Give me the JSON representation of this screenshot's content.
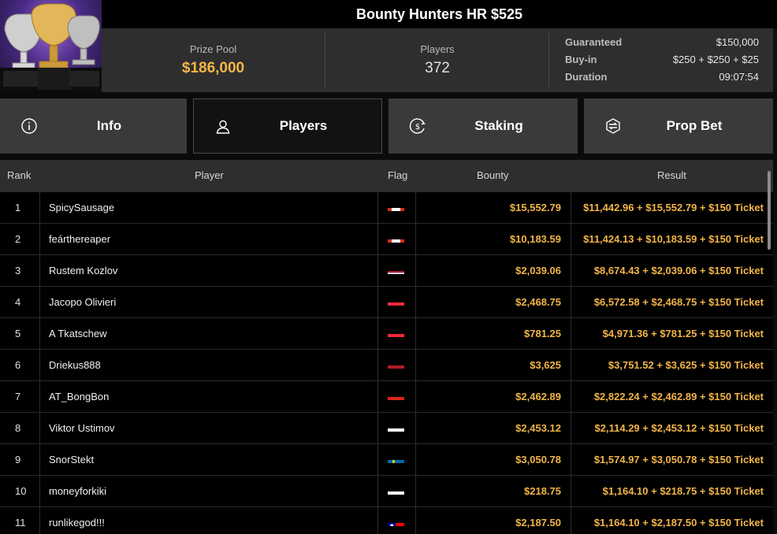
{
  "header": {
    "title": "Bounty Hunters HR $525",
    "prize_pool_label": "Prize Pool",
    "prize_pool_value": "$186,000",
    "players_label": "Players",
    "players_value": "372",
    "details": [
      {
        "key": "Guaranteed",
        "value": "$150,000"
      },
      {
        "key": "Buy-in",
        "value": "$250 + $250 + $25"
      },
      {
        "key": "Duration",
        "value": "09:07:54"
      }
    ]
  },
  "tabs": [
    {
      "label": "Info",
      "icon": "info-icon",
      "active": false
    },
    {
      "label": "Players",
      "icon": "user-icon",
      "active": true
    },
    {
      "label": "Staking",
      "icon": "dollar-circle-icon",
      "active": false
    },
    {
      "label": "Prop Bet",
      "icon": "prop-bet-icon",
      "active": false
    }
  ],
  "table": {
    "headers": {
      "rank": "Rank",
      "player": "Player",
      "flag": "Flag",
      "bounty": "Bounty",
      "result": "Result"
    },
    "rows": [
      {
        "rank": "1",
        "player": "SpicySausage",
        "flag": "canada",
        "bounty": "$15,552.79",
        "result": "$11,442.96 + $15,552.79 + $150 Ticket"
      },
      {
        "rank": "2",
        "player": "feárthereaper",
        "flag": "canada",
        "bounty": "$10,183.59",
        "result": "$11,424.13 + $10,183.59 + $150 Ticket"
      },
      {
        "rank": "3",
        "player": "Rustem Kozlov",
        "flag": "thailand",
        "bounty": "$2,039.06",
        "result": "$8,674.43 + $2,039.06 + $150 Ticket"
      },
      {
        "rank": "4",
        "player": "Jacopo Olivieri",
        "flag": "austria",
        "bounty": "$2,468.75",
        "result": "$6,572.58 + $2,468.75 + $150 Ticket"
      },
      {
        "rank": "5",
        "player": "A Tkatschew",
        "flag": "austria",
        "bounty": "$781.25",
        "result": "$4,971.36 + $781.25 + $150 Ticket"
      },
      {
        "rank": "6",
        "player": "Driekus888",
        "flag": "netherlands",
        "bounty": "$3,625",
        "result": "$3,751.52 + $3,625 + $150 Ticket"
      },
      {
        "rank": "7",
        "player": "AT_BongBon",
        "flag": "vietnam",
        "bounty": "$2,462.89",
        "result": "$2,822.24 + $2,462.89 + $150 Ticket"
      },
      {
        "rank": "8",
        "player": "Viktor Ustimov",
        "flag": "russia",
        "bounty": "$2,453.12",
        "result": "$2,114.29 + $2,453.12 + $150 Ticket"
      },
      {
        "rank": "9",
        "player": "SnorStekt",
        "flag": "sweden",
        "bounty": "$3,050.78",
        "result": "$1,574.97 + $3,050.78 + $150 Ticket"
      },
      {
        "rank": "10",
        "player": "moneyforkiki",
        "flag": "poland",
        "bounty": "$218.75",
        "result": "$1,164.10 + $218.75 + $150 Ticket"
      },
      {
        "rank": "11",
        "player": "runlikegod!!!",
        "flag": "taiwan",
        "bounty": "$2,187.50",
        "result": "$1,164.10 + $2,187.50 + $150 Ticket"
      }
    ]
  },
  "colors": {
    "accent_gold": "#f3b548",
    "panel": "#2e2e2e",
    "tab_bg": "#3a3a3a",
    "row_bg": "#000000"
  }
}
